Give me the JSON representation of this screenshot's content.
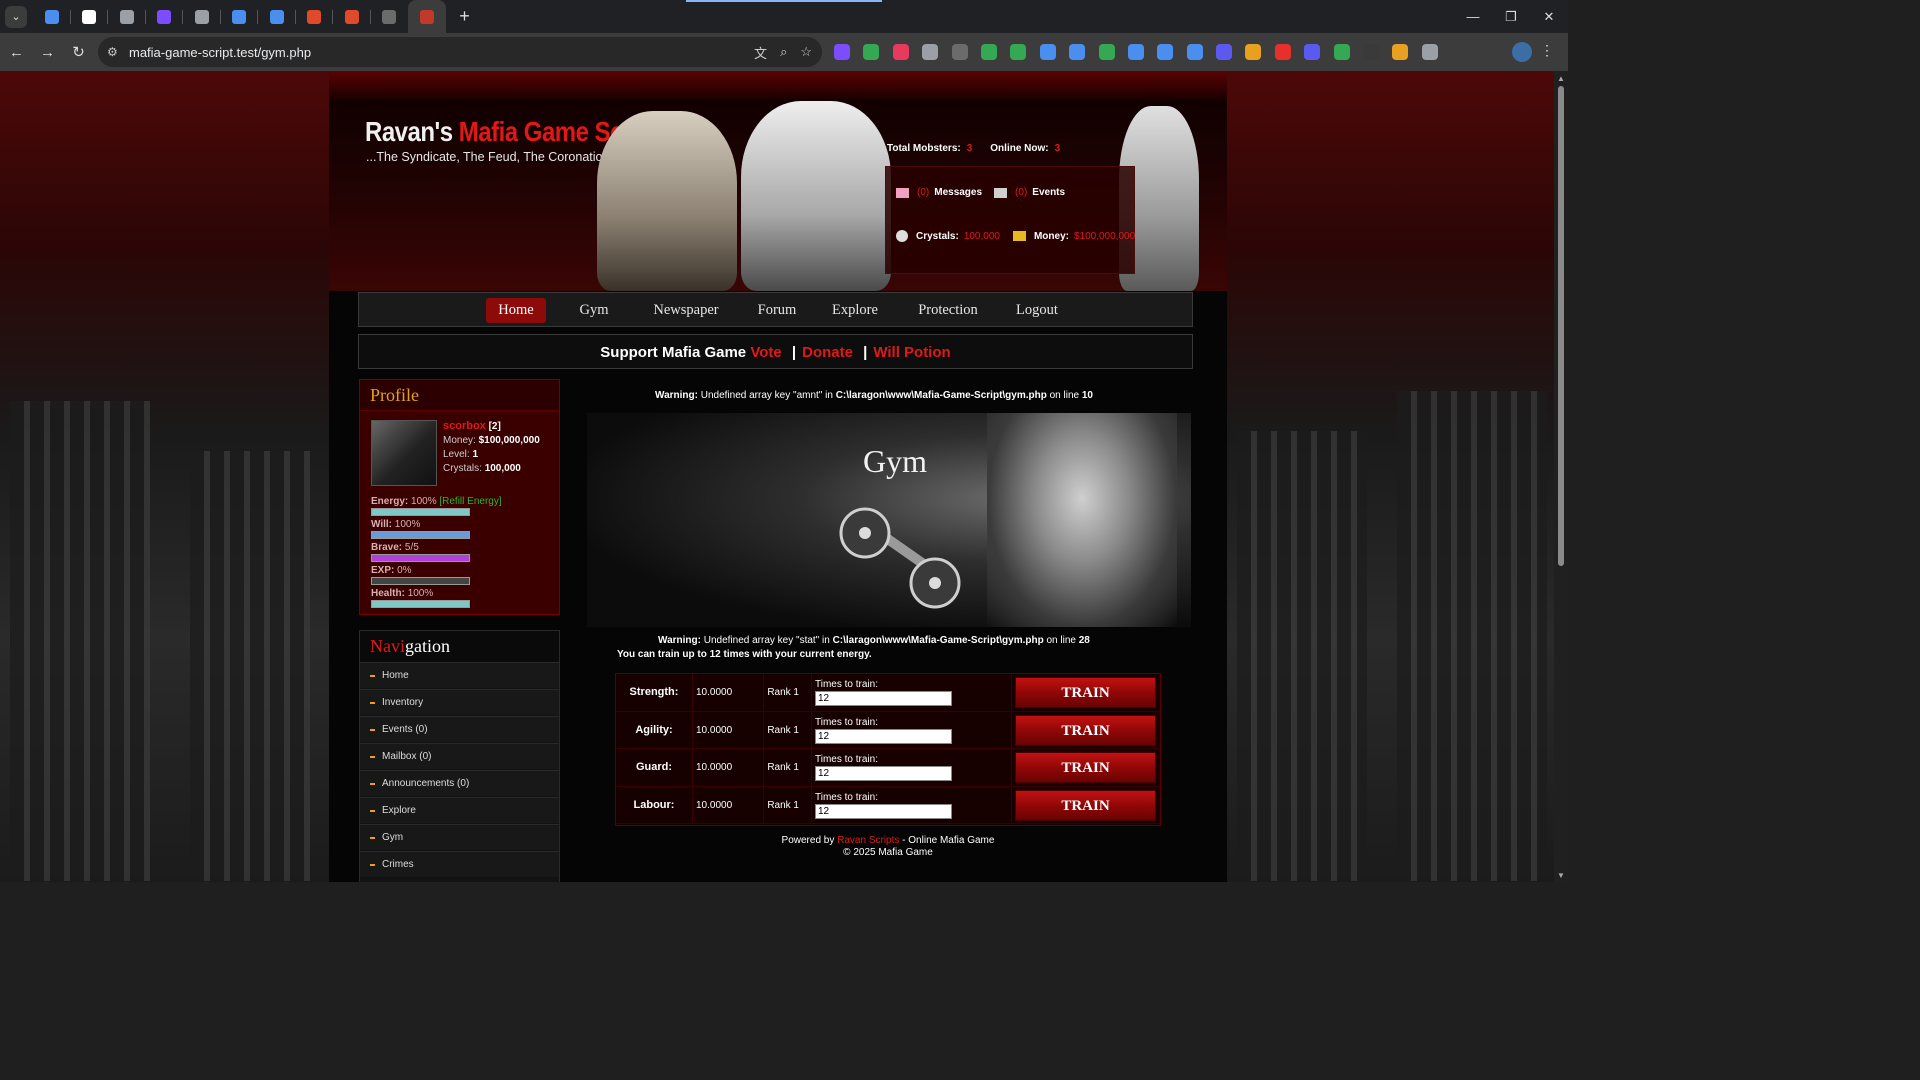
{
  "browser": {
    "url": "mafia-game-script.test/gym.php",
    "tabs_count": 11,
    "tab_favicon_colors": [
      "#4a8ff0",
      "#ffffff",
      "#9aa0a6",
      "#7c4dff",
      "#9aa0a6",
      "#4a8ff0",
      "#4a8ff0",
      "#e04a2a",
      "#e04a2a",
      "#6b6b6b",
      "#c0392b"
    ],
    "extension_colors": [
      "#7c4dff",
      "#34a853",
      "#e83a5c",
      "#9aa0a6",
      "#6b6b6b",
      "#34a853",
      "#34a853",
      "#4a8ff0",
      "#4a8ff0",
      "#34a853",
      "#4a8ff0",
      "#4a8ff0",
      "#4a8ff0",
      "#5a5af0",
      "#e8a020",
      "#e8302a",
      "#5a5af0",
      "#34a853",
      "#3a3a3a",
      "#e8a020",
      "#9aa0a6"
    ]
  },
  "header": {
    "logo_part1": "Ravan's",
    "logo_part2": "Mafia Game Script",
    "tagline": "...The Syndicate, The Feud, The Coronation",
    "total_mobsters_label": "Total Mobsters:",
    "total_mobsters": "3",
    "online_now_label": "Online Now:",
    "online_now": "3",
    "messages_count": "(0)",
    "messages_label": "Messages",
    "events_count": "(0)",
    "events_label": "Events",
    "crystals_label": "Crystals:",
    "crystals": "100,000",
    "money_label": "Money:",
    "money": "$100,000,000"
  },
  "menu": {
    "items": [
      "Home",
      "Gym",
      "Newspaper",
      "Forum",
      "Explore",
      "Protection",
      "Logout"
    ],
    "active": "Home"
  },
  "support": {
    "prefix": "Support Mafia Game",
    "vote": "Vote",
    "sep": "|",
    "donate": "Donate",
    "will_potion": "Will Potion"
  },
  "profile": {
    "title": "Profile",
    "username": "scorbox",
    "user_id": "[2]",
    "money_label": "Money:",
    "money": "$100,000,000",
    "level_label": "Level:",
    "level": "1",
    "crystals_label": "Crystals:",
    "crystals": "100,000",
    "energy_label": "Energy:",
    "energy": "100%",
    "refill": "[Refill Energy]",
    "will_label": "Will:",
    "will": "100%",
    "brave_label": "Brave:",
    "brave": "5/5",
    "exp_label": "EXP:",
    "exp": "0%",
    "health_label": "Health:",
    "health": "100%",
    "bars": {
      "energy": 1.0,
      "will": 1.0,
      "brave": 1.0,
      "exp": 0.0,
      "health": 1.0
    },
    "bar_colors": {
      "energy": "#7ec8c8",
      "will": "#6a9ad8",
      "brave": "#b040d8",
      "exp": "#e04040",
      "health": "#7ec8c8"
    }
  },
  "navigation": {
    "title_red": "Navi",
    "title_white": "gation",
    "items": [
      "Home",
      "Inventory",
      "Events (0)",
      "Mailbox (0)",
      "Announcements (0)",
      "Explore",
      "Gym",
      "Crimes"
    ]
  },
  "warnings": {
    "w1_label": "Warning:",
    "w1_text": " Undefined array key \"amnt\" in ",
    "w1_path": "C:\\laragon\\www\\Mafia-Game-Script\\gym.php",
    "w1_online": " on line ",
    "w1_line": "10",
    "w2_label": "Warning:",
    "w2_text": " Undefined array key \"stat\" in ",
    "w2_path": "C:\\laragon\\www\\Mafia-Game-Script\\gym.php",
    "w2_online": " on line ",
    "w2_line": "28"
  },
  "gym": {
    "title": "Gym",
    "hint": "You can train up to 12 times with your current energy.",
    "times_label": "Times to train:",
    "button": "TRAIN",
    "stats": [
      {
        "name": "Strength:",
        "value": "10.0000",
        "rank": "Rank 1",
        "times": "12"
      },
      {
        "name": "Agility:",
        "value": "10.0000",
        "rank": "Rank 1",
        "times": "12"
      },
      {
        "name": "Guard:",
        "value": "10.0000",
        "rank": "Rank 1",
        "times": "12"
      },
      {
        "name": "Labour:",
        "value": "10.0000",
        "rank": "Rank 1",
        "times": "12"
      }
    ]
  },
  "footer": {
    "powered_by": "Powered by",
    "ravan": "Ravan Scripts",
    "suffix": "- Online Mafia Game",
    "copyright": "© 2025 Mafia Game"
  }
}
